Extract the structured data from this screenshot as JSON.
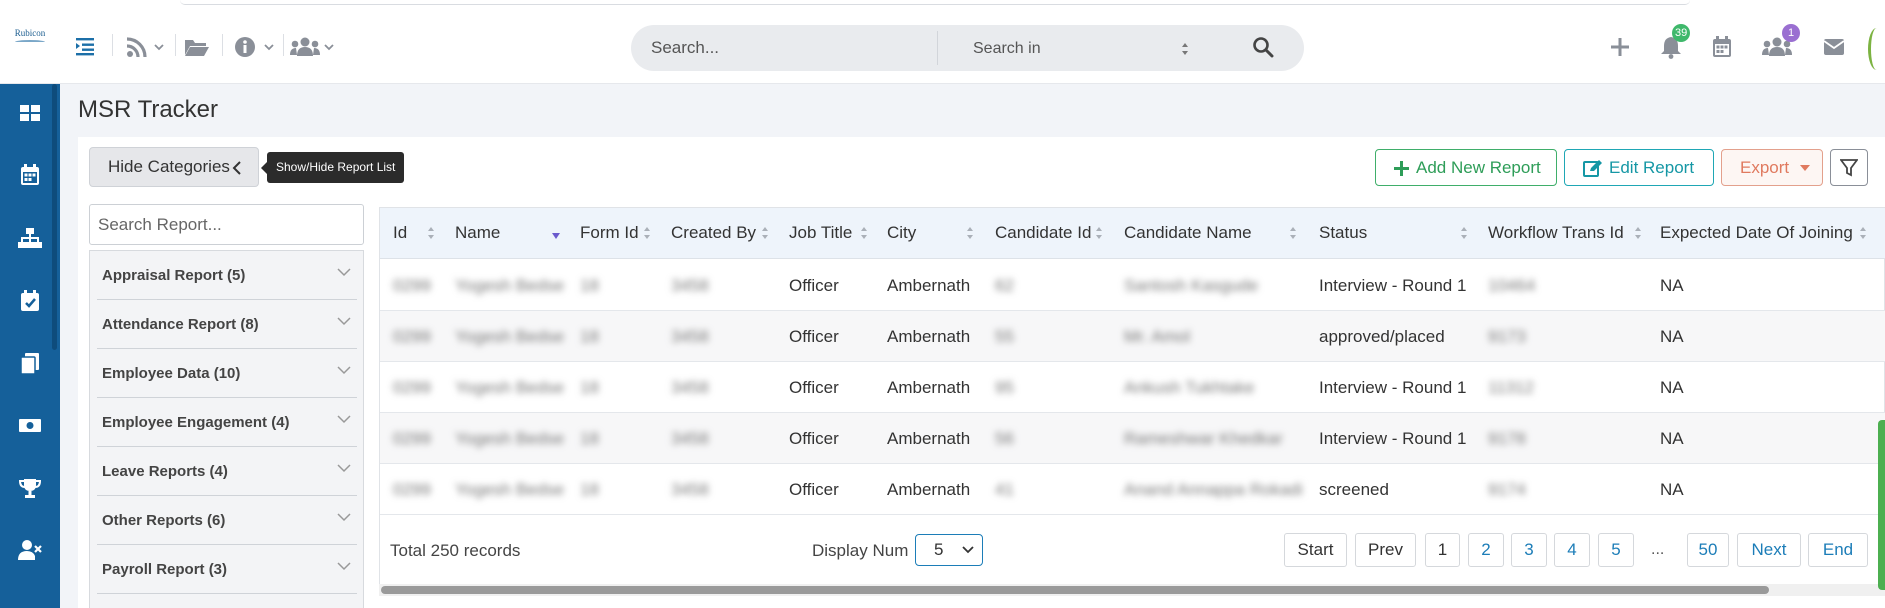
{
  "app": {
    "logo_text": "Rubicon",
    "page_title": "MSR Tracker"
  },
  "header": {
    "search_placeholder": "Search...",
    "search_in_label": "Search in",
    "notifications_count": "39",
    "team_count": "1",
    "icons": [
      "menu-toggle-icon",
      "rss-icon",
      "folder-icon",
      "info-icon",
      "users-icon",
      "plus-icon",
      "bell-icon",
      "calendar-icon",
      "team-icon",
      "mail-icon"
    ]
  },
  "sidebar": {
    "items": [
      "dashboard-icon",
      "calendar-icon",
      "org-chart-icon",
      "calendar-check-icon",
      "documents-icon",
      "money-icon",
      "trophy-icon",
      "user-remove-icon"
    ]
  },
  "toolbar": {
    "hide_categories_label": "Hide Categories",
    "tooltip": "Show/Hide Report List",
    "add_label": "Add New Report",
    "edit_label": "Edit Report",
    "export_label": "Export"
  },
  "categories": {
    "search_placeholder": "Search Report...",
    "items": [
      {
        "label": "Appraisal Report (5)"
      },
      {
        "label": "Attendance Report (8)"
      },
      {
        "label": "Employee Data (10)"
      },
      {
        "label": "Employee Engagement (4)"
      },
      {
        "label": "Leave Reports (4)"
      },
      {
        "label": "Other Reports (6)"
      },
      {
        "label": "Payroll Report (3)"
      }
    ]
  },
  "table": {
    "columns": [
      "Id",
      "Name",
      "Form Id",
      "Created By",
      "Job Title",
      "City",
      "Candidate Id",
      "Candidate Name",
      "Status",
      "Workflow Trans Id",
      "Expected Date Of Joining"
    ],
    "rows": [
      {
        "id": "0299",
        "name": "Yogesh Bedse",
        "form_id": "18",
        "created_by": "3458",
        "job_title": "Officer",
        "city": "Ambernath",
        "candidate_id": "62",
        "candidate_name": "Santosh Kasgude",
        "status": "Interview - Round 1",
        "workflow_trans_id": "10464",
        "doj": "NA"
      },
      {
        "id": "0299",
        "name": "Yogesh Bedse",
        "form_id": "18",
        "created_by": "3458",
        "job_title": "Officer",
        "city": "Ambernath",
        "candidate_id": "55",
        "candidate_name": "Mr. Amol",
        "status": "approved/placed",
        "workflow_trans_id": "9173",
        "doj": "NA"
      },
      {
        "id": "0299",
        "name": "Yogesh Bedse",
        "form_id": "18",
        "created_by": "3458",
        "job_title": "Officer",
        "city": "Ambernath",
        "candidate_id": "95",
        "candidate_name": "Ankush Tukhtake",
        "status": "Interview - Round 1",
        "workflow_trans_id": "11312",
        "doj": "NA"
      },
      {
        "id": "0299",
        "name": "Yogesh Bedse",
        "form_id": "18",
        "created_by": "3458",
        "job_title": "Officer",
        "city": "Ambernath",
        "candidate_id": "56",
        "candidate_name": "Rameshwar Khedkar",
        "status": "Interview - Round 1",
        "workflow_trans_id": "9178",
        "doj": "NA"
      },
      {
        "id": "0299",
        "name": "Yogesh Bedse",
        "form_id": "18",
        "created_by": "3458",
        "job_title": "Officer",
        "city": "Ambernath",
        "candidate_id": "41",
        "candidate_name": "Anand Annappa Rokadi",
        "status": "screened",
        "workflow_trans_id": "9174",
        "doj": "NA"
      }
    ]
  },
  "pagination": {
    "total_label": "Total 250 records",
    "display_label": "Display Num",
    "display_value": "5",
    "start": "Start",
    "prev": "Prev",
    "pages": [
      "1",
      "2",
      "3",
      "4",
      "5"
    ],
    "ellipsis": "...",
    "last_page": "50",
    "next": "Next",
    "end": "End"
  },
  "colors": {
    "sidebar": "#15609a",
    "add": "#2e9d58",
    "edit": "#1597a5",
    "export": "#e07a5f",
    "notif_badge": "#3fb86b",
    "team_badge": "#9a6fd1"
  }
}
